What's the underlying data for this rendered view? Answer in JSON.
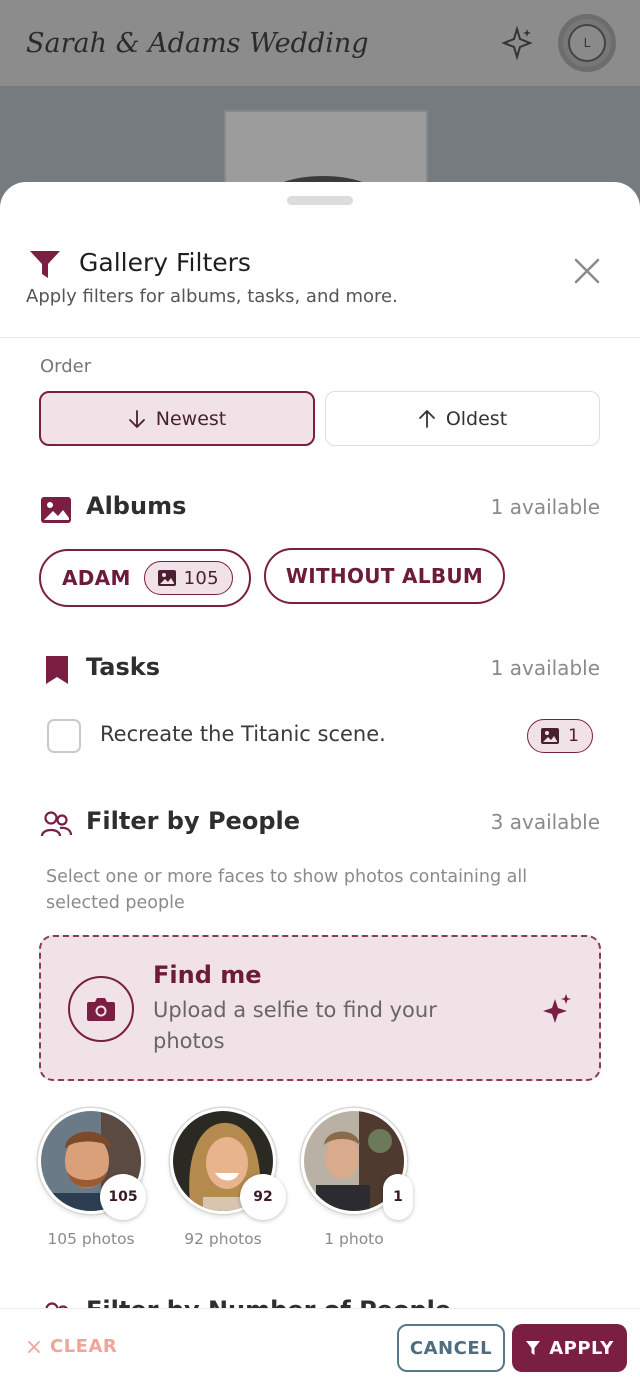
{
  "app": {
    "title": "Sarah & Adams Wedding",
    "avatar_initial": "L"
  },
  "sheet": {
    "title": "Gallery Filters",
    "subtitle": "Apply filters for albums, tasks, and more.",
    "order": {
      "label": "Order",
      "options": [
        {
          "label": "Newest",
          "selected": true
        },
        {
          "label": "Oldest",
          "selected": false
        }
      ]
    },
    "albums": {
      "title": "Albums",
      "count": "1 available",
      "chips": [
        {
          "label": "ADAM",
          "badge": "105"
        },
        {
          "label": "WITHOUT ALBUM"
        }
      ]
    },
    "tasks": {
      "title": "Tasks",
      "count": "1 available",
      "items": [
        {
          "label": "Recreate the Titanic scene.",
          "badge": "1",
          "checked": false
        }
      ]
    },
    "people": {
      "title": "Filter by People",
      "count": "3 available",
      "description": "Select one or more faces to show photos containing all selected people",
      "find_me": {
        "title": "Find me",
        "subtitle": "Upload a selfie to find your photos"
      },
      "faces": [
        {
          "count": "105",
          "label": "105 photos"
        },
        {
          "count": "92",
          "label": "92 photos"
        },
        {
          "count": "1",
          "label": "1 photo"
        }
      ]
    },
    "next_section_title": "Filter by Number of People"
  },
  "footer": {
    "clear": "CLEAR",
    "cancel": "CANCEL",
    "apply": "APPLY"
  },
  "colors": {
    "accent": "#7a1f42",
    "accent_bg": "#f0e2e6",
    "clear": "#f0a59b",
    "cancel": "#4f6d7e"
  }
}
